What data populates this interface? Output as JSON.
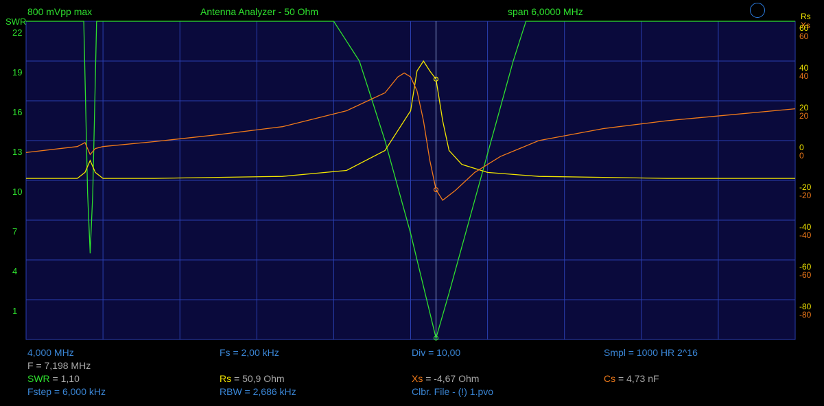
{
  "header": {
    "amplitude": "800 mVpp max",
    "mode": "Antenna Analyzer - 50 Ohm",
    "span": "span 6,0000 MHz"
  },
  "axes": {
    "left_title": "SWR",
    "right_title_rs": "Rs",
    "right_title_xs": "Xs",
    "left_ticks": [
      "22",
      "19",
      "16",
      "13",
      "10",
      "7",
      "4",
      "1"
    ],
    "rs_ticks": [
      "60",
      "40",
      "20",
      "0",
      "-20",
      "-40",
      "-60",
      "-80"
    ],
    "xs_ticks": [
      "60",
      "40",
      "20",
      "0",
      "-20",
      "-40",
      "-60",
      "-80"
    ]
  },
  "readout": {
    "start_freq": "4,000 MHz",
    "fs": "Fs = 2,00 kHz",
    "div": "Div = 10,00",
    "smpl": "Smpl = 1000 HR  2^16",
    "f_cursor": "F = 7,198 MHz",
    "swr_label": "SWR",
    "swr_value": " = 1,10",
    "rs_label": "Rs",
    "rs_value": " = 50,9 Ohm",
    "xs_label": "Xs",
    "xs_value": " = -4,67 Ohm",
    "cs_label": "Cs",
    "cs_value": " = 4,73 nF",
    "fstep": "Fstep = 6,000 kHz",
    "rbw": "RBW = 2,686 kHz",
    "clbr": "Clbr. File - (!) 1.pvo"
  },
  "colors": {
    "swr": "#2ee02e",
    "rs": "#f2e600",
    "xs": "#f07a1a",
    "grid": "#2a3fb0",
    "plot_bg": "#0a0a3c",
    "blue_text": "#3a86d6"
  },
  "chart_data": {
    "type": "line",
    "title": "Antenna Analyzer - 50 Ohm",
    "x_range_mhz": [
      4.0,
      10.0
    ],
    "cursor_mhz": 7.198,
    "series": [
      {
        "name": "SWR",
        "axis": "left",
        "ylim": [
          1,
          25
        ],
        "x": [
          4.0,
          4.4,
          4.45,
          4.48,
          4.5,
          4.52,
          4.55,
          4.6,
          4.65,
          5.0,
          5.5,
          6.0,
          6.2,
          6.4,
          6.6,
          6.7,
          6.8,
          6.9,
          7.0,
          7.1,
          7.198,
          7.3,
          7.4,
          7.5,
          7.6,
          7.7,
          7.8,
          7.9,
          8.0,
          8.2,
          8.6,
          9.0,
          10.0
        ],
        "values": [
          25,
          25,
          25,
          12,
          7.5,
          12,
          25,
          25,
          25,
          25,
          25,
          25,
          25,
          25,
          22,
          19,
          16,
          12.5,
          9,
          5,
          1.1,
          4.5,
          8,
          11.5,
          15,
          18.5,
          22,
          25,
          25,
          25,
          25,
          25,
          25
        ]
      },
      {
        "name": "Rs",
        "axis": "right",
        "ylim": [
          -80,
          80
        ],
        "x": [
          4.0,
          4.4,
          4.46,
          4.5,
          4.54,
          4.6,
          5.0,
          5.5,
          6.0,
          6.5,
          6.8,
          7.0,
          7.05,
          7.1,
          7.15,
          7.198,
          7.25,
          7.3,
          7.4,
          7.6,
          8.0,
          8.5,
          9.0,
          10.0
        ],
        "values": [
          1,
          1,
          4,
          10,
          4,
          1,
          1,
          1.5,
          2,
          5,
          15,
          35,
          55,
          60,
          55,
          50.9,
          30,
          15,
          8,
          4,
          2,
          1.5,
          1,
          1
        ]
      },
      {
        "name": "Xs",
        "axis": "right",
        "ylim": [
          -80,
          80
        ],
        "x": [
          4.0,
          4.4,
          4.46,
          4.5,
          4.54,
          4.6,
          5.0,
          5.5,
          6.0,
          6.5,
          6.8,
          6.9,
          6.95,
          7.0,
          7.05,
          7.1,
          7.15,
          7.198,
          7.25,
          7.35,
          7.5,
          7.7,
          8.0,
          8.5,
          9.0,
          9.5,
          10.0
        ],
        "values": [
          14,
          17,
          19,
          13,
          16,
          17,
          19.5,
          23,
          27,
          35,
          44,
          52,
          54,
          52,
          45,
          30,
          10,
          -4.67,
          -10,
          -5,
          4,
          12,
          20,
          26,
          30,
          33,
          36
        ]
      }
    ]
  }
}
